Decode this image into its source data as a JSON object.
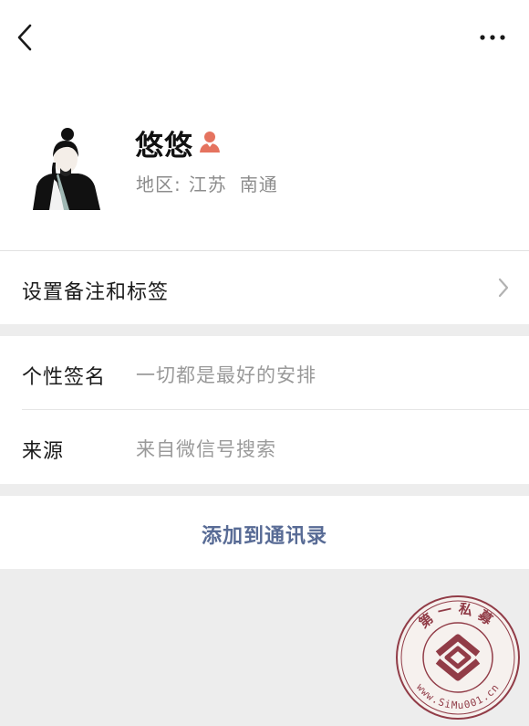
{
  "topbar": {
    "back_icon": "chevron-left-icon",
    "more_icon": "more-dots-icon"
  },
  "profile": {
    "name": "悠悠",
    "gender_icon": "female-user-icon",
    "region_label": "地区:",
    "region_province": "江苏",
    "region_city": "南通"
  },
  "remark": {
    "label": "设置备注和标签"
  },
  "info": {
    "signature_label": "个性签名",
    "signature_value": "一切都是最好的安排",
    "source_label": "来源",
    "source_value": "来自微信号搜索"
  },
  "actions": {
    "add_contact": "添加到通讯录"
  },
  "watermark": {
    "top_text": "第一私募",
    "bottom_text": "www.SiMu001.cn"
  },
  "colors": {
    "link_blue": "#586b95",
    "gender_red": "#e5735f",
    "watermark_red": "#8a2d3a",
    "page_bg": "#ededed"
  }
}
